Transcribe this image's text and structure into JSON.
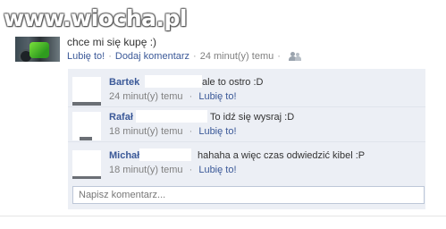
{
  "watermark": {
    "text": "www.wiocha.pl"
  },
  "post": {
    "text": "chce mi się kupę :)",
    "like_label": "Lubię to!",
    "comment_label": "Dodaj komentarz",
    "time_label": "24 minut(y) temu",
    "separator": "·",
    "privacy_icon": "people-icon"
  },
  "comments": [
    {
      "author": "Bartek",
      "text": "ale to ostro :D",
      "time": "24 minut(y) temu",
      "like": "Lubię to!"
    },
    {
      "author": "Rafał",
      "text": "To idź się wysraj :D",
      "time": "18 minut(y) temu",
      "like": "Lubię to!"
    },
    {
      "author": "Michał",
      "text": "hahaha a więc czas odwiedzić kibel :P",
      "time": "18 minut(y) temu",
      "like": "Lubię to!"
    }
  ],
  "write_comment": {
    "placeholder": "Napisz komentarz..."
  },
  "colors": {
    "link": "#3b5998",
    "comment_bg": "#eceff5",
    "meta": "#808080"
  }
}
